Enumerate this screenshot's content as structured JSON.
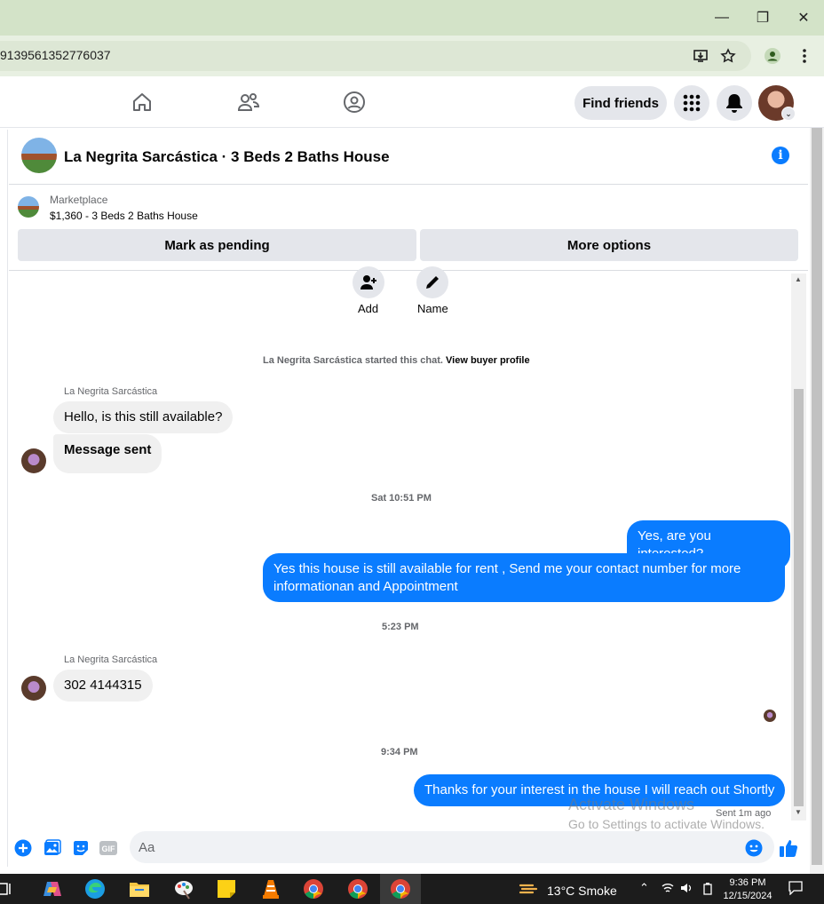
{
  "browser": {
    "url": "9139561352776037",
    "window_controls": {
      "minimize": "—",
      "restore": "❐",
      "close": "✕"
    }
  },
  "fbnav": {
    "find_friends_label": "Find friends"
  },
  "chat": {
    "title": "La Negrita Sarcástica · 3 Beds 2 Baths House",
    "marketplace": {
      "label": "Marketplace",
      "listing": "$1,360 - 3 Beds 2 Baths House",
      "mark_pending_label": "Mark as pending",
      "more_options_label": "More options"
    },
    "actions": {
      "add_label": "Add",
      "name_label": "Name"
    },
    "system_message": "La Negrita Sarcástica started this chat.",
    "view_buyer_profile": "View buyer profile",
    "messages": [
      {
        "sender": "La Negrita Sarcástica",
        "text": "Hello, is this still available?"
      },
      {
        "text": "Message sent"
      },
      {
        "timestamp": "Sat 10:51 PM"
      },
      {
        "text": "Yes, are you interested?"
      },
      {
        "text": "Yes this house is still available for rent , Send me your contact number for more informationan and Appointment"
      },
      {
        "timestamp": "5:23 PM"
      },
      {
        "sender": "La Negrita Sarcástica",
        "text": "302 4144315"
      },
      {
        "timestamp": "9:34 PM"
      },
      {
        "text": "Thanks for your interest in the house I will reach out Shortly"
      }
    ],
    "sent_status": "Sent 1m ago",
    "composer_placeholder": "Aa"
  },
  "watermark": {
    "line1": "Activate Windows",
    "line2": "Go to Settings to activate Windows."
  },
  "taskbar": {
    "weather": "13°C  Smoke",
    "time": "9:36 PM",
    "date": "12/15/2024"
  },
  "colors": {
    "messenger_blue": "#0a7cff",
    "incoming_bubble": "#f0f0f0",
    "chrome_titlebar": "#d3e3c8"
  }
}
